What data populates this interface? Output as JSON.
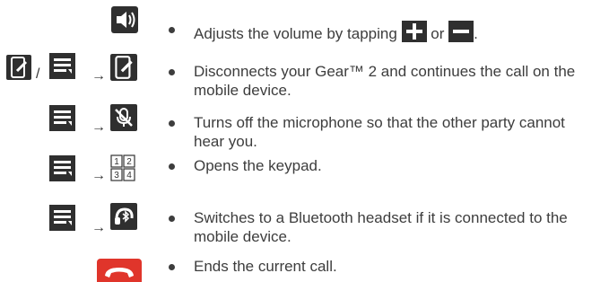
{
  "items": [
    {
      "icons": [
        "volume-icon"
      ],
      "text_before": "Adjusts the volume by tapping",
      "text_or": "or",
      "text_after": ".",
      "inline_icons": [
        "plus-icon",
        "minus-icon"
      ]
    },
    {
      "icons": [
        "phone-handset-icon",
        "menu-icon",
        "phone-handset-icon"
      ],
      "separator": "/",
      "arrow": "→",
      "text": "Disconnects your Gear™ 2 and continues the call on the mobile device."
    },
    {
      "icons": [
        "menu-icon",
        "microphone-mute-icon"
      ],
      "arrow": "→",
      "text": "Turns off the microphone so that the other party cannot hear you."
    },
    {
      "icons": [
        "menu-icon",
        "keypad-icon"
      ],
      "arrow": "→",
      "keypad_digits": [
        "1",
        "2",
        "3",
        "4"
      ],
      "text": "Opens the keypad."
    },
    {
      "icons": [
        "menu-icon",
        "bluetooth-headset-icon"
      ],
      "arrow": "→",
      "text": "Switches to a Bluetooth headset if it is connected to the mobile device."
    },
    {
      "icons": [
        "end-call-icon"
      ],
      "text": "Ends the current call."
    }
  ],
  "colors": {
    "icon_bg": "#2f2f2f",
    "icon_fg": "#ffffff",
    "end_call": "#e0352b",
    "text": "#3d3d3d"
  }
}
